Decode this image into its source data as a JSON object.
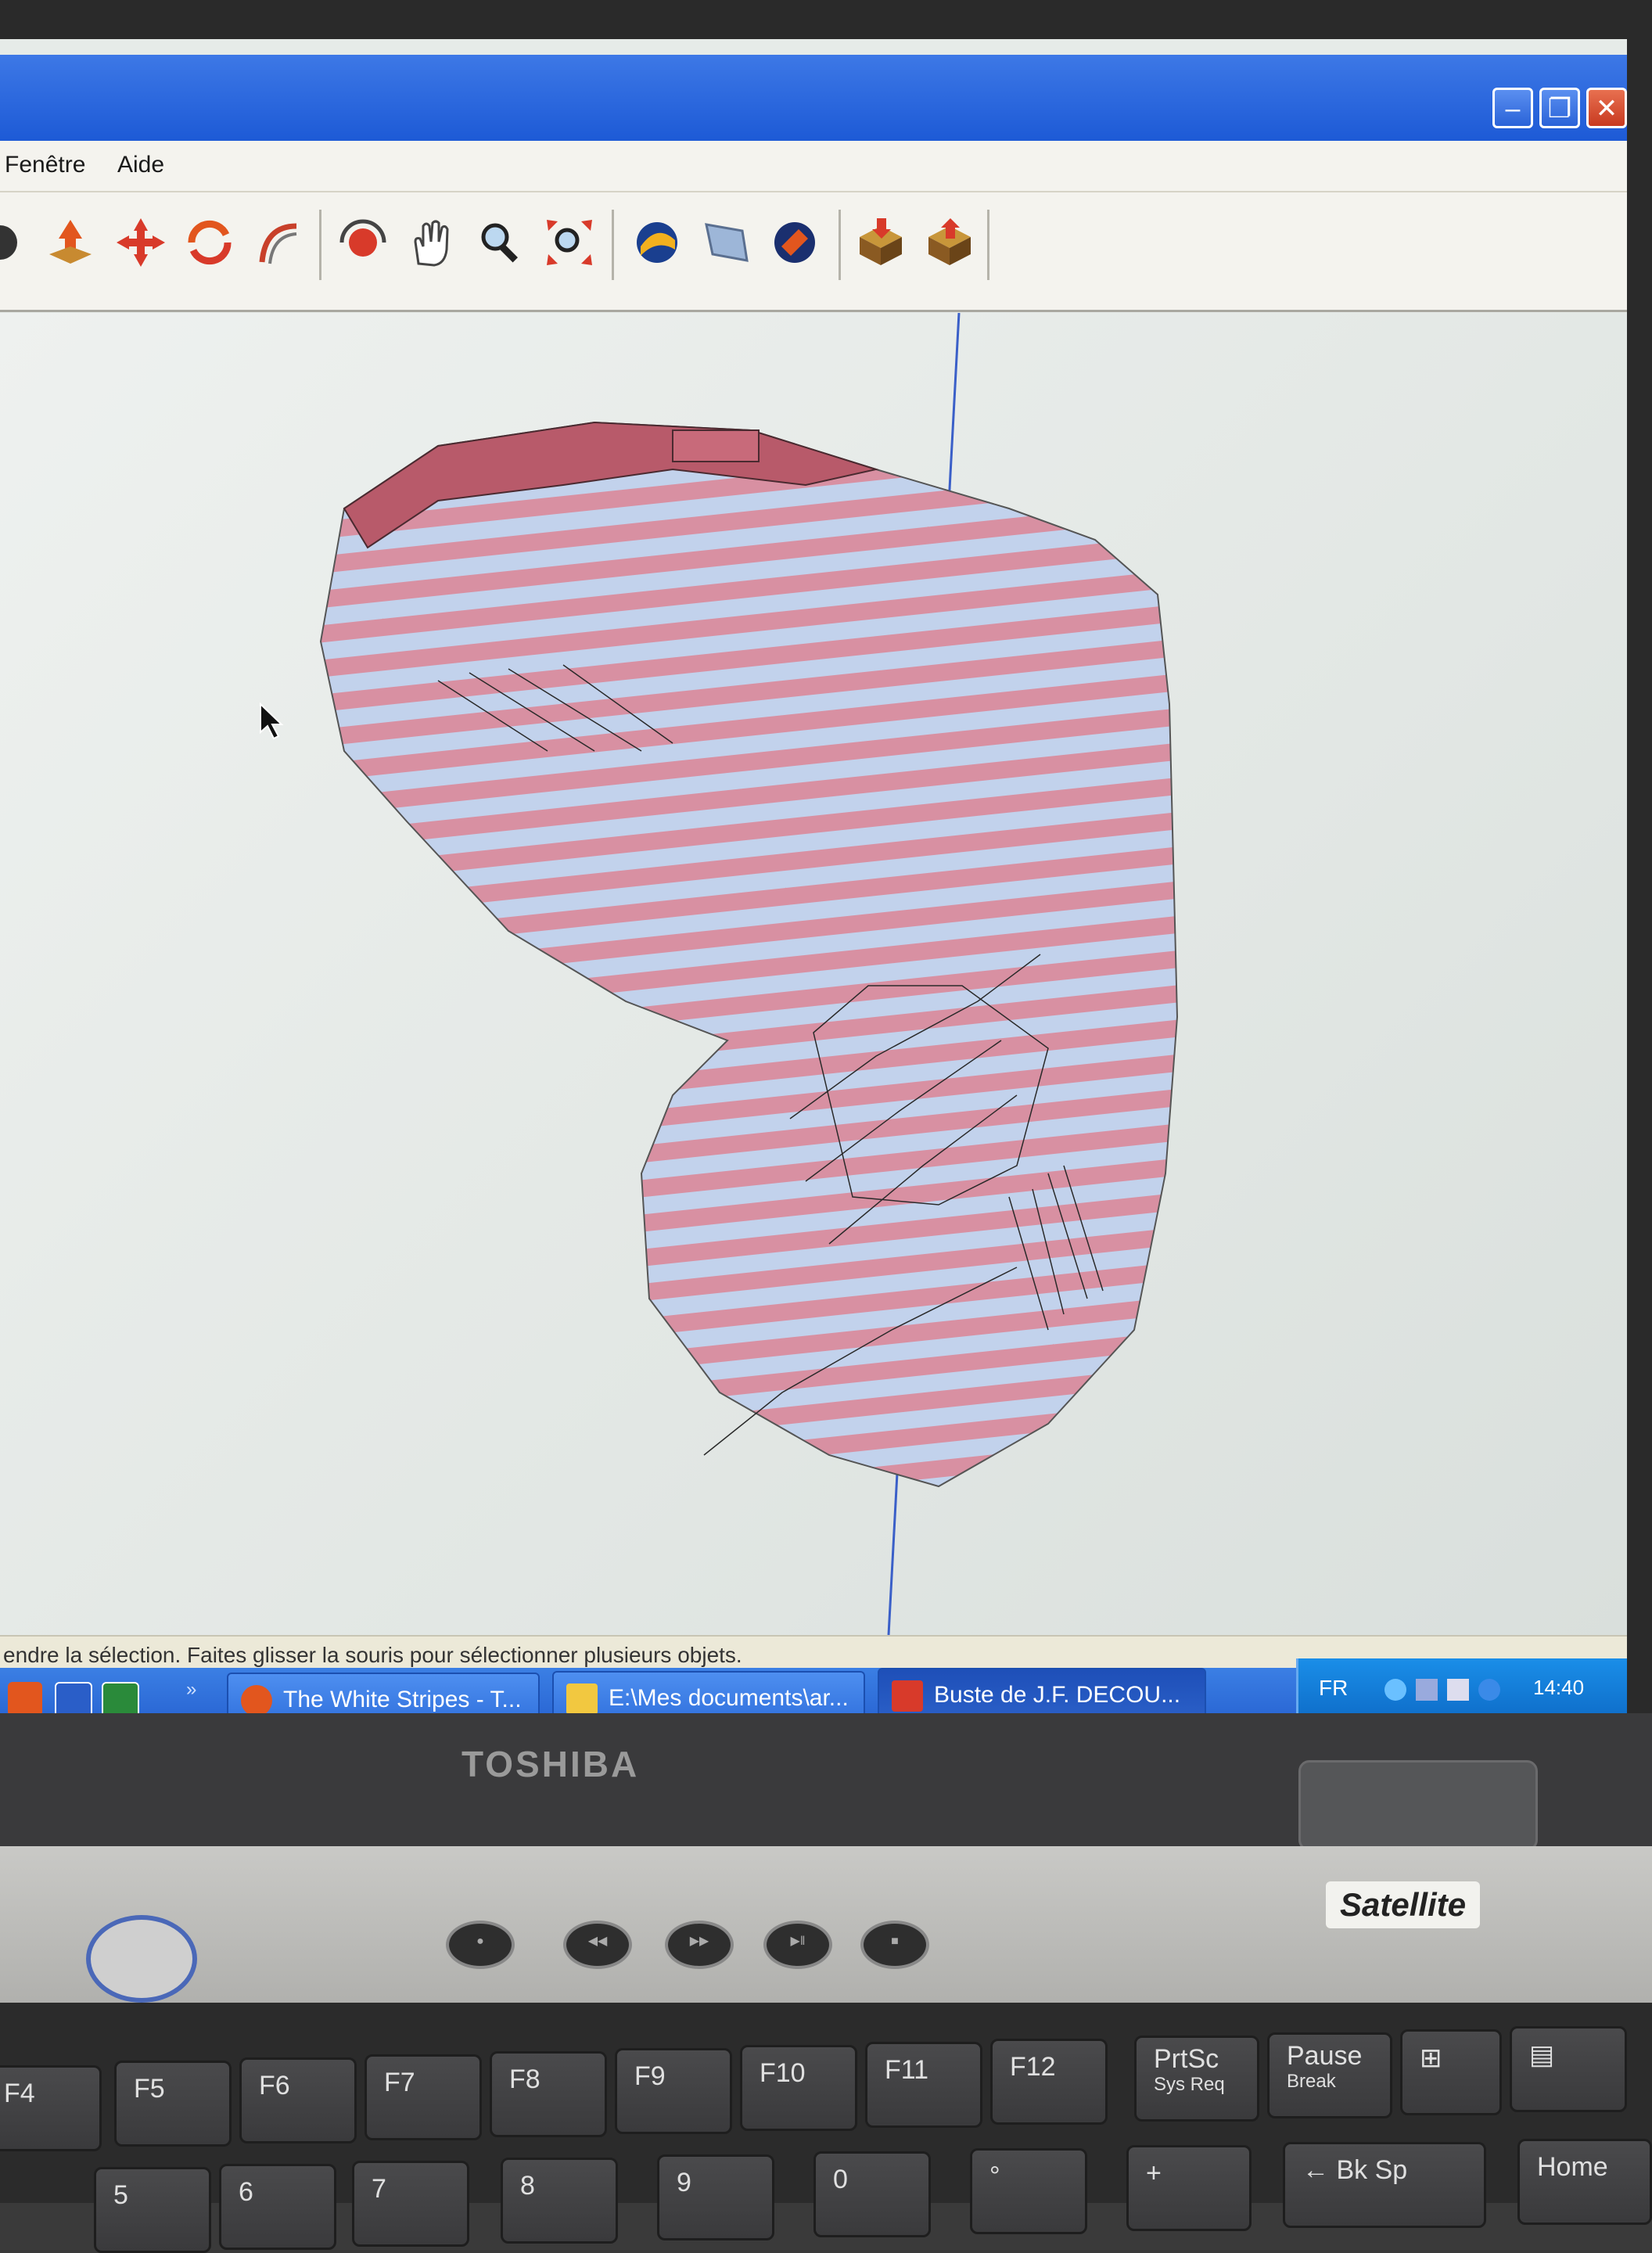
{
  "menu": {
    "items": [
      "Fenêtre",
      "Aide"
    ]
  },
  "toolbar": {
    "icons": [
      "orbit-icon",
      "push-pull-icon",
      "move-icon",
      "rotate-icon",
      "follow-me-icon",
      "orbit-tool-icon",
      "pan-icon",
      "zoom-icon",
      "zoom-extents-icon",
      "get-models-icon",
      "share-model-icon",
      "components-icon",
      "warehouse-get-icon",
      "warehouse-share-icon"
    ]
  },
  "status": {
    "text": "endre la sélection. Faites glisser la souris pour sélectionner plusieurs objets."
  },
  "taskbar": {
    "tasks": [
      {
        "label": "The White Stripes - T...",
        "icon": "firefox-icon"
      },
      {
        "label": "E:\\Mes documents\\ar...",
        "icon": "folder-icon"
      },
      {
        "label": "Buste de J.F. DECOU...",
        "icon": "sketchup-icon",
        "active": true
      }
    ],
    "language": "FR",
    "clock": "14:40",
    "quicklaunch_chevron": "»"
  },
  "laptop": {
    "brand": "TOSHIBA",
    "model": "Satellite",
    "keys": [
      {
        "label": "F4"
      },
      {
        "label": "F5"
      },
      {
        "label": "F6"
      },
      {
        "label": "F7"
      },
      {
        "label": "F8"
      },
      {
        "label": "F9"
      },
      {
        "label": "F10"
      },
      {
        "label": "F11"
      },
      {
        "label": "F12"
      },
      {
        "label": "PrtSc",
        "sub": "Sys Req"
      },
      {
        "label": "Pause",
        "sub": "Break"
      }
    ],
    "bottom_keys": [
      "5",
      "6",
      "7",
      "8",
      "9",
      "0",
      "°",
      "+",
      "← Bk Sp",
      "Home"
    ]
  }
}
